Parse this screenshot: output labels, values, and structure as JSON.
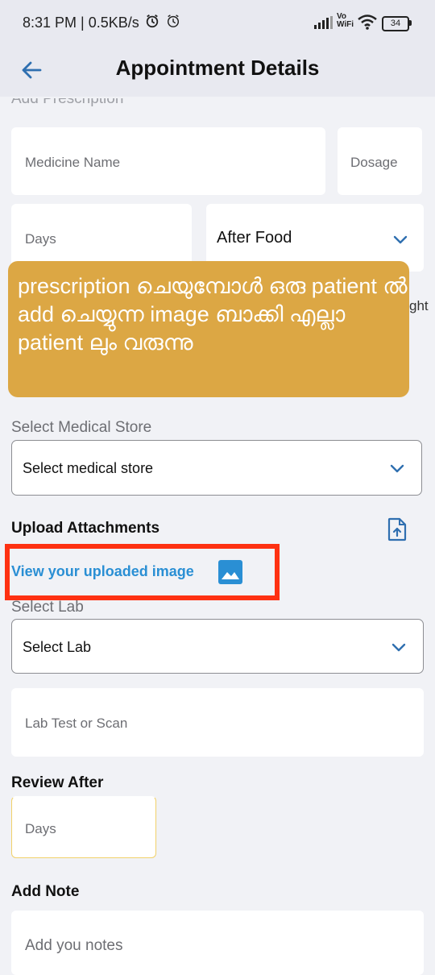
{
  "status_bar": {
    "time_speed": "8:31 PM | 0.5KB/s",
    "vowifi": "Vo\nWiFi",
    "battery": "34",
    "icons": [
      "alarm-icon",
      "alarm-icon",
      "signal-icon",
      "wifi-icon",
      "battery-icon"
    ]
  },
  "appbar": {
    "title": "Appointment Details",
    "back_icon": "arrow-left-icon"
  },
  "prescription": {
    "section_title": "Add Prescription",
    "medicine_placeholder": "Medicine Name",
    "dosage_placeholder": "Dosage",
    "days_placeholder": "Days",
    "timing_value": "After Food",
    "peek_text": "ght"
  },
  "overlay": {
    "text": "prescription ചെയുമ്പോൾ ഒരു patient ൽ add ചെയ്യുന്ന image ബാക്കി എല്ലാ patient ലും വരുന്നു"
  },
  "medical_store": {
    "label": "Select Medical Store",
    "value": "Select medical store"
  },
  "attachments": {
    "label": "Upload Attachments",
    "view_link": "View your uploaded image",
    "upload_icon": "upload-file-icon",
    "image_icon": "image-icon"
  },
  "lab": {
    "label": "Select Lab",
    "value": "Select Lab",
    "test_placeholder": "Lab Test or Scan"
  },
  "review": {
    "label": "Review After",
    "days_placeholder": "Days"
  },
  "note": {
    "label": "Add Note",
    "placeholder": "Add you notes"
  },
  "colors": {
    "accent_blue": "#2a8fd4",
    "overlay_bg": "#dca744",
    "highlight_red": "#fe3112"
  }
}
